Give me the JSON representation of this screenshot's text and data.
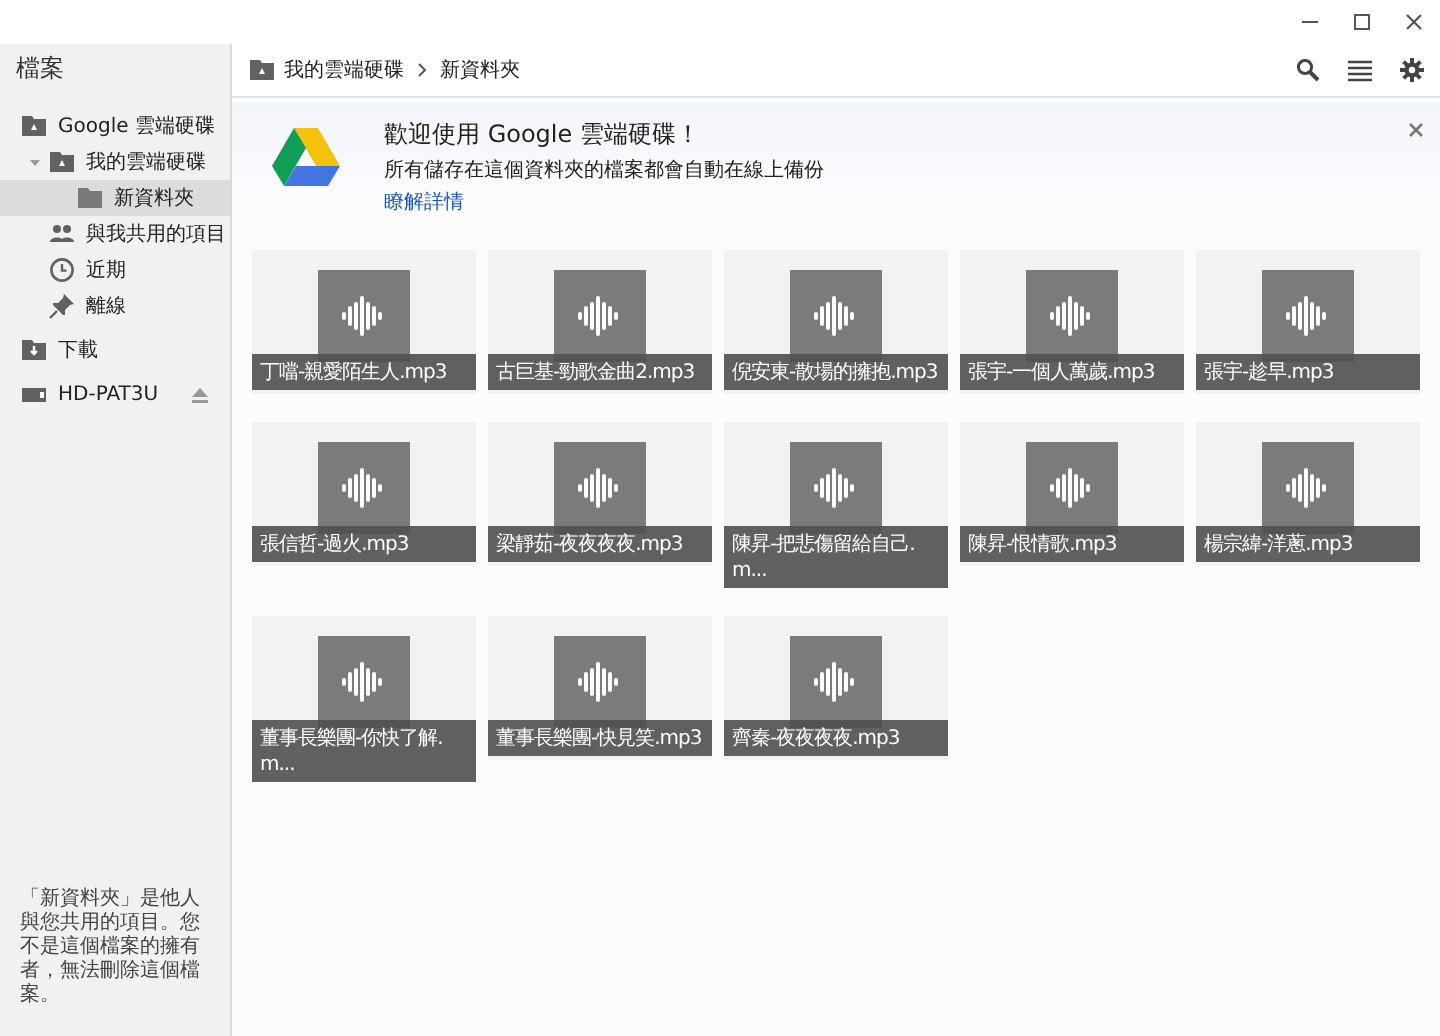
{
  "sidebar": {
    "title": "檔案",
    "items": [
      {
        "label": "Google 雲端硬碟",
        "selected": false,
        "children": [
          {
            "label": "我的雲端硬碟",
            "selected": false,
            "expanded": true,
            "children": [
              {
                "label": "新資料夾",
                "selected": true
              }
            ]
          },
          {
            "label": "與我共用的項目",
            "selected": false
          },
          {
            "label": "近期",
            "selected": false
          },
          {
            "label": "離線",
            "selected": false
          }
        ]
      },
      {
        "label": "下載",
        "selected": false
      },
      {
        "label": "HD-PAT3U",
        "selected": false
      }
    ],
    "note": "「新資料夾」是他人與您共用的項目。您不是這個檔案的擁有者，無法刪除這個檔案。"
  },
  "breadcrumb": [
    "我的雲端硬碟",
    "新資料夾"
  ],
  "banner": {
    "title": "歡迎使用 Google 雲端硬碟！",
    "text": "所有儲存在這個資料夾的檔案都會自動在線上備份",
    "link": "瞭解詳情"
  },
  "files": [
    {
      "name": "丁噹-親愛陌生人.mp3"
    },
    {
      "name": "古巨基-勁歌金曲2.mp3"
    },
    {
      "name": "倪安東-散場的擁抱.mp3"
    },
    {
      "name": "張宇-一個人萬歲.mp3"
    },
    {
      "name": "張宇-趁早.mp3"
    },
    {
      "name": "張信哲-過火.mp3"
    },
    {
      "name": "梁靜茹-夜夜夜夜.mp3"
    },
    {
      "name": "陳昇-把悲傷留給自己.m..."
    },
    {
      "name": "陳昇-恨情歌.mp3"
    },
    {
      "name": "楊宗緯-洋蔥.mp3"
    },
    {
      "name": "董事長樂團-你快了解.m..."
    },
    {
      "name": "董事長樂團-快見笑.mp3"
    },
    {
      "name": "齊秦-夜夜夜夜.mp3"
    }
  ]
}
